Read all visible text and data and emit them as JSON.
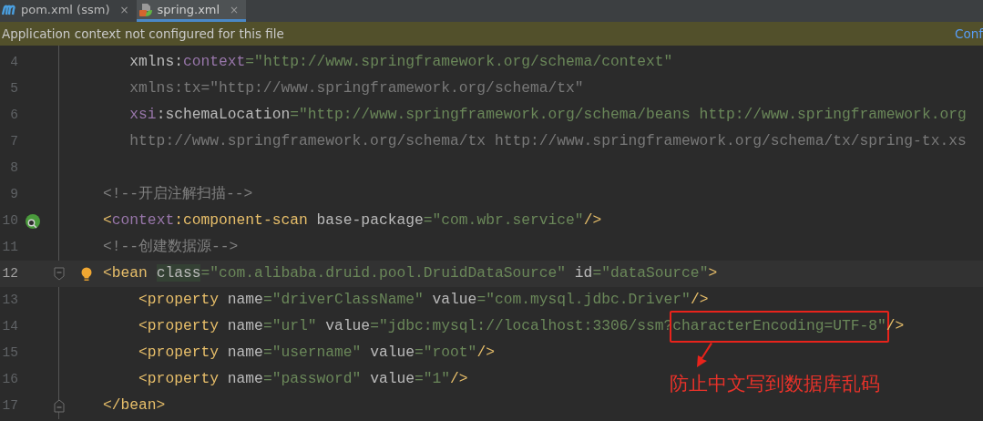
{
  "tabs": [
    {
      "label": "pom.xml (ssm)",
      "close": "×",
      "selected": false
    },
    {
      "label": "spring.xml",
      "close": "×",
      "selected": true
    }
  ],
  "banner": {
    "text": "Application context not configured for this file",
    "link": "Conf"
  },
  "lines": [
    {
      "number": "4",
      "tokens": [
        {
          "kind": "plain",
          "text": "   xmlns:"
        },
        {
          "kind": "ns",
          "text": "context"
        },
        {
          "kind": "str",
          "text": "=\"http://www.springframework.org/schema/context\""
        }
      ]
    },
    {
      "number": "5",
      "tokens": [
        {
          "kind": "faded",
          "text": "   xmlns:tx=\"http://www.springframework.org/schema/tx\""
        }
      ]
    },
    {
      "number": "6",
      "tokens": [
        {
          "kind": "ns",
          "text": "   xsi"
        },
        {
          "kind": "plain",
          "text": ":schemaLocation"
        },
        {
          "kind": "str",
          "text": "=\"http://www.springframework.org/schema/beans http://www.springframework.org"
        }
      ]
    },
    {
      "number": "7",
      "tokens": [
        {
          "kind": "faded",
          "text": "   http://www.springframework.org/schema/tx http://www.springframework.org/schema/tx/spring-tx.xs"
        }
      ]
    },
    {
      "number": "8"
    },
    {
      "number": "9",
      "tokens": [
        {
          "kind": "comment",
          "text": "<!--开启注解扫描-->"
        }
      ]
    },
    {
      "number": "10",
      "bean_marker": true,
      "tokens": [
        {
          "kind": "tag",
          "text": "<"
        },
        {
          "kind": "ns",
          "text": "context"
        },
        {
          "kind": "tag",
          "text": ":component-scan"
        },
        {
          "kind": "plain",
          "text": " base-package"
        },
        {
          "kind": "str",
          "text": "=\"com.wbr.service\""
        },
        {
          "kind": "tag",
          "text": "/>"
        }
      ]
    },
    {
      "number": "11",
      "tokens": [
        {
          "kind": "comment",
          "text": "<!--创建数据源-->"
        }
      ]
    },
    {
      "number": "12",
      "current": true,
      "fold_start": true,
      "bulb": true,
      "tokens": [
        {
          "kind": "tag",
          "text": "<bean "
        },
        {
          "kind": "plain",
          "text": "class",
          "highlight": true
        },
        {
          "kind": "str",
          "text": "=\"com.alibaba.druid.pool.DruidDataSource\""
        },
        {
          "kind": "plain",
          "text": " id"
        },
        {
          "kind": "str",
          "text": "=\"dataSource\""
        },
        {
          "kind": "tag",
          "text": ">"
        }
      ]
    },
    {
      "number": "13",
      "tokens": [
        {
          "kind": "tag",
          "text": "    <property"
        },
        {
          "kind": "plain",
          "text": " name"
        },
        {
          "kind": "str",
          "text": "=\"driverClassName\""
        },
        {
          "kind": "plain",
          "text": " value"
        },
        {
          "kind": "str",
          "text": "=\"com.mysql.jdbc.Driver\""
        },
        {
          "kind": "tag",
          "text": "/>"
        }
      ]
    },
    {
      "number": "14",
      "tokens": [
        {
          "kind": "tag",
          "text": "    <property"
        },
        {
          "kind": "plain",
          "text": " name"
        },
        {
          "kind": "str",
          "text": "=\"url\""
        },
        {
          "kind": "plain",
          "text": " value"
        },
        {
          "kind": "str",
          "text": "=\"jdbc:mysql://localhost:3306/ssm?"
        },
        {
          "kind": "str",
          "text": "characterEncoding=UTF-8\"",
          "boxed": true
        },
        {
          "kind": "tag",
          "text": "/>"
        }
      ]
    },
    {
      "number": "15",
      "tokens": [
        {
          "kind": "tag",
          "text": "    <property"
        },
        {
          "kind": "plain",
          "text": " name"
        },
        {
          "kind": "str",
          "text": "=\"username\""
        },
        {
          "kind": "plain",
          "text": " value"
        },
        {
          "kind": "str",
          "text": "=\"root\""
        },
        {
          "kind": "tag",
          "text": "/>"
        }
      ]
    },
    {
      "number": "16",
      "tokens": [
        {
          "kind": "tag",
          "text": "    <property"
        },
        {
          "kind": "plain",
          "text": " name"
        },
        {
          "kind": "str",
          "text": "=\"password\""
        },
        {
          "kind": "plain",
          "text": " value"
        },
        {
          "kind": "str",
          "text": "=\"1\""
        },
        {
          "kind": "tag",
          "text": "/>"
        }
      ]
    },
    {
      "number": "17",
      "fold_end": true,
      "tokens": [
        {
          "kind": "tag",
          "text": "</bean>"
        }
      ]
    }
  ],
  "annotation": {
    "text": "防止中文写到数据库乱码"
  }
}
